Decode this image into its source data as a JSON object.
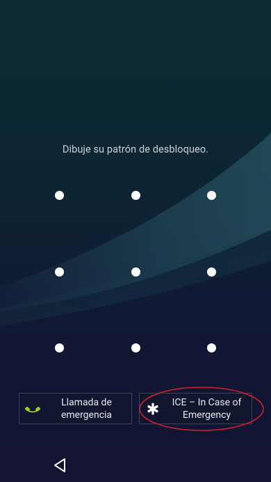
{
  "lock_screen": {
    "prompt": "Dibuje su patrón de desbloqueo.",
    "pattern_grid": {
      "rows": 3,
      "cols": 3,
      "dots": [
        "1",
        "2",
        "3",
        "4",
        "5",
        "6",
        "7",
        "8",
        "9"
      ]
    }
  },
  "buttons": {
    "emergency_call": {
      "label": "Llamada de\nemergencia",
      "icon": "phone-icon",
      "icon_color": "#9acd32"
    },
    "ice": {
      "label": "ICE – In Case of\nEmergency",
      "icon": "asterisk-icon",
      "icon_color": "#ffffff"
    }
  },
  "annotation": {
    "color": "#d0202a"
  },
  "nav_bar": {
    "back": "back-icon"
  }
}
